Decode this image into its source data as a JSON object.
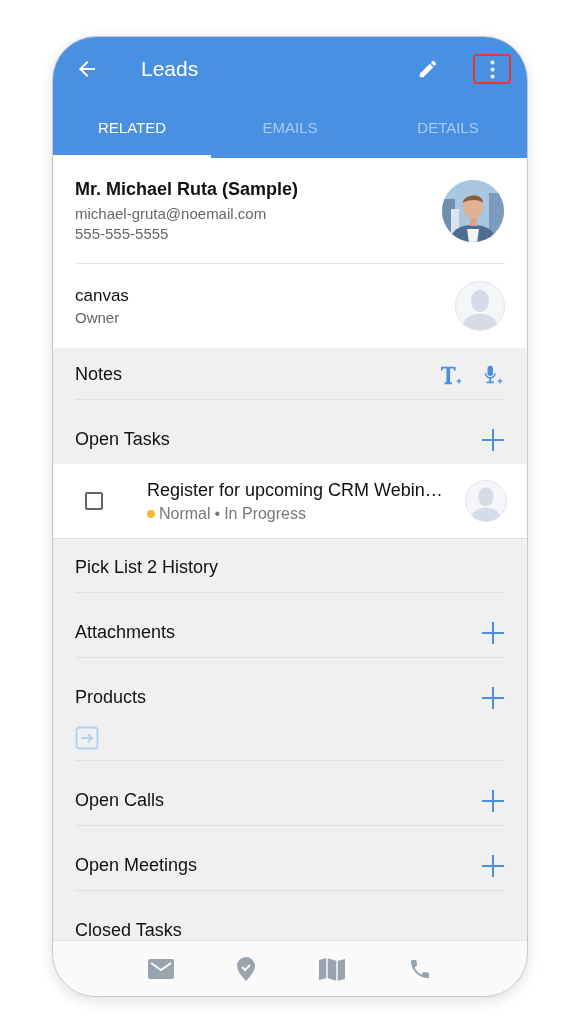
{
  "toolbar": {
    "title": "Leads"
  },
  "tabs": [
    {
      "label": "RELATED",
      "selected": true
    },
    {
      "label": "EMAILS",
      "selected": false
    },
    {
      "label": "DETAILS",
      "selected": false
    }
  ],
  "contact": {
    "name": "Mr. Michael Ruta (Sample)",
    "email": "michael-gruta@noemail.com",
    "phone": "555-555-5555"
  },
  "owner": {
    "name": "canvas",
    "role": "Owner"
  },
  "sections": [
    {
      "title": "Notes",
      "kind": "notes"
    },
    {
      "title": "Open Tasks",
      "kind": "add",
      "tasks": [
        {
          "title": "Register for upcoming CRM Webin…",
          "checked": false,
          "priority": "Normal",
          "separator": "•",
          "color": "#f5b82e",
          "status": "In Progress"
        }
      ]
    },
    {
      "title": "Pick List 2 History",
      "kind": "none"
    },
    {
      "title": "Attachments",
      "kind": "add"
    },
    {
      "title": "Products",
      "kind": "add_link"
    },
    {
      "title": "Open Calls",
      "kind": "add"
    },
    {
      "title": "Open Meetings",
      "kind": "add"
    },
    {
      "title": "Closed Tasks",
      "kind": "none"
    }
  ]
}
